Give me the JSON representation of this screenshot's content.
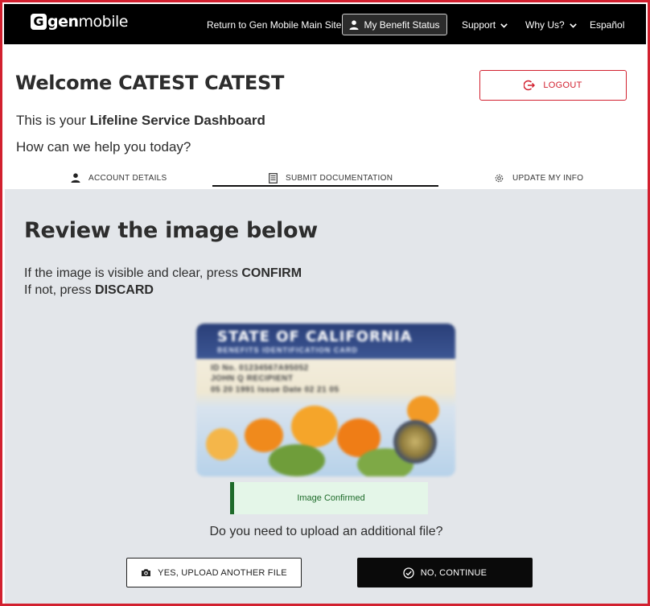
{
  "nav": {
    "logo_letter": "G",
    "logo_gen": "gen",
    "logo_mobile": "mobile",
    "return_link": "Return to Gen Mobile Main Site",
    "benefit_status": "My Benefit Status",
    "support": "Support",
    "why_us": "Why Us?",
    "language": "Español",
    "user_icon": "user-icon",
    "chevron_icon": "chevron-down-icon"
  },
  "header": {
    "welcome": "Welcome CATEST CATEST",
    "logout_label": "LOGOUT",
    "logout_icon": "logout-icon",
    "dash_prefix": "This is your ",
    "dash_bold": "Lifeline Service Dashboard",
    "help": "How can we help you today?"
  },
  "tabs": [
    {
      "label": "ACCOUNT DETAILS",
      "icon": "person-icon"
    },
    {
      "label": "SUBMIT DOCUMENTATION",
      "icon": "document-icon",
      "active": true
    },
    {
      "label": "UPDATE MY INFO",
      "icon": "gear-icon"
    }
  ],
  "review": {
    "title": "Review the image below",
    "line1_prefix": "If the image is visible and clear, press ",
    "line1_bold": "CONFIRM",
    "line2_prefix": "If not, press ",
    "line2_bold": "DISCARD"
  },
  "card": {
    "state": "STATE OF CALIFORNIA",
    "subtitle": "BENEFITS IDENTIFICATION CARD",
    "id_line": "ID No. 01234567A95052",
    "name_line": "JOHN Q RECIPIENT",
    "date_line": "05 20 1991   Issue Date 02 21 05"
  },
  "status": {
    "confirmed": "Image Confirmed",
    "question": "Do you need to upload an additional file?"
  },
  "buttons": {
    "upload_label": "YES, UPLOAD ANOTHER FILE",
    "upload_icon": "camera-icon",
    "continue_label": "NO, CONTINUE",
    "continue_icon": "check-circle-icon"
  },
  "colors": {
    "brand_red": "#d2202f",
    "nav_black": "#000000",
    "content_gray": "#e3e6ea",
    "success_green": "#1e6b2a",
    "success_bg": "#e4f6e8"
  }
}
